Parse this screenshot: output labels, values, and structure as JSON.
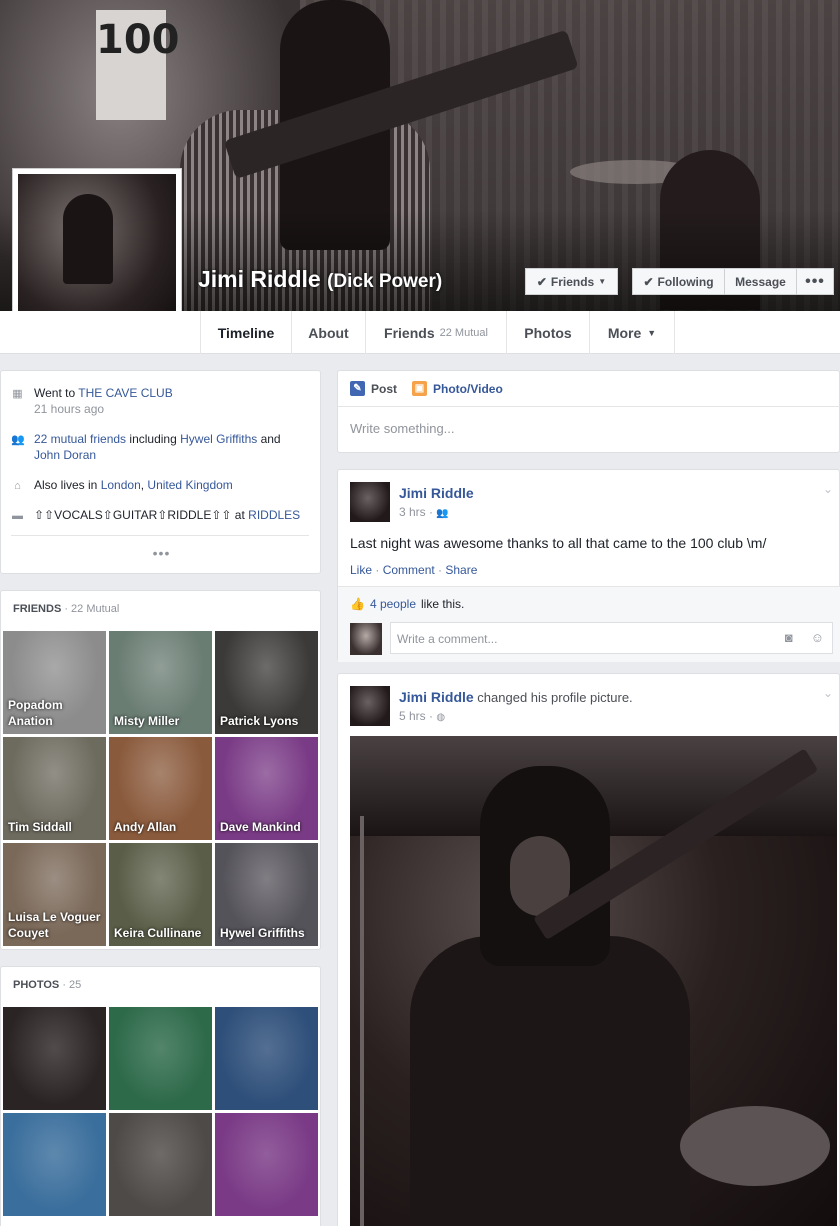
{
  "profile": {
    "name": "Jimi Riddle",
    "alternate_name": "(Dick Power)"
  },
  "cover_buttons": {
    "friends": "Friends",
    "following": "Following",
    "message": "Message",
    "more": "•••"
  },
  "tabs": [
    {
      "label": "Timeline"
    },
    {
      "label": "About"
    },
    {
      "label": "Friends",
      "sub": "22 Mutual"
    },
    {
      "label": "Photos"
    },
    {
      "label": "More"
    }
  ],
  "intro": {
    "went_prefix": "Went to ",
    "went_place": "THE CAVE CLUB",
    "went_time": "21 hours ago",
    "mutual_link": "22 mutual friends",
    "mutual_mid": " including ",
    "mutual_f1": "Hywel Griffiths",
    "mutual_and": " and ",
    "mutual_f2": "John Doran",
    "lives_prefix": "Also lives in ",
    "lives_city": "London",
    "lives_sep": ", ",
    "lives_country": "United Kingdom",
    "work_title": "⇧⇧VOCALS⇧GUITAR⇧RIDDLE⇧⇧",
    "work_at": " at ",
    "work_place": "RIDDLES",
    "more": "•••"
  },
  "friends_section": {
    "title": "FRIENDS",
    "sub": " · 22 Mutual",
    "items": [
      {
        "name": "Popadom Anation",
        "bg": "#8c8c8c"
      },
      {
        "name": "Misty Miller",
        "bg": "#6a7d73"
      },
      {
        "name": "Patrick Lyons",
        "bg": "#3c3a38"
      },
      {
        "name": "Tim Siddall",
        "bg": "#6d6a5e"
      },
      {
        "name": "Andy Allan",
        "bg": "#8a5a3c"
      },
      {
        "name": "Dave Mankind",
        "bg": "#7a3b86"
      },
      {
        "name": "Luisa Le Voguer Couyet",
        "bg": "#7a6858"
      },
      {
        "name": "Keira Cullinane",
        "bg": "#5a5e48"
      },
      {
        "name": "Hywel Griffiths",
        "bg": "#55535a"
      }
    ]
  },
  "photos_section": {
    "title": "PHOTOS",
    "sub": " · 25",
    "items": [
      {
        "bg": "#2b2424"
      },
      {
        "bg": "#2d6a4a"
      },
      {
        "bg": "#2e4f7a"
      },
      {
        "bg": "#3a6e9c"
      },
      {
        "bg": "#4e4a48"
      },
      {
        "bg": "#7a3a86"
      }
    ]
  },
  "composer": {
    "post_label": "Post",
    "photo_label": "Photo/Video",
    "placeholder": "Write something..."
  },
  "post1": {
    "author": "Jimi Riddle",
    "time": "3 hrs ·",
    "text": "Last night was awesome thanks to all that came to the 100 club \\m/",
    "like": "Like",
    "comment": "Comment",
    "share": "Share",
    "likes_link": "4 people",
    "likes_rest": "like this.",
    "comment_placeholder": "Write a comment..."
  },
  "post2": {
    "author": "Jimi Riddle",
    "action": " changed his profile picture.",
    "time": "5 hrs ·"
  },
  "colors": {
    "link": "#365899",
    "background": "#e9ebee",
    "post_icon": "#4267b2",
    "photo_icon": "#f5a24a"
  },
  "icons": {
    "calendar": "calendar-icon",
    "friends": "friends-icon",
    "home": "home-icon",
    "work": "briefcase-icon"
  }
}
